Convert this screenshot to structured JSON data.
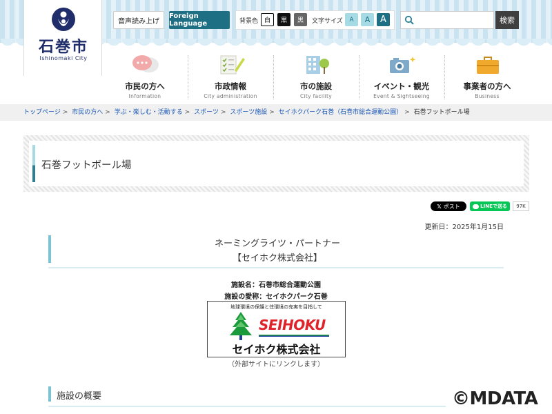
{
  "header": {
    "logo": {
      "name": "石巻市",
      "sub": "Ishinomaki City"
    },
    "voice_label": "音声読み上げ",
    "language_label": "Foreign Language",
    "bg_color_label": "背景色",
    "bg_options": [
      "白",
      "黒",
      "黒"
    ],
    "font_size_label": "文字サイズ",
    "font_sizes": [
      "A",
      "A",
      "A"
    ],
    "search": {
      "placeholder": "",
      "button": "検索"
    }
  },
  "nav": [
    {
      "label": "市民の方へ",
      "sub": "Information",
      "icon": "speech-bubbles-icon"
    },
    {
      "label": "市政情報",
      "sub": "City administration",
      "icon": "checklist-pencil-icon"
    },
    {
      "label": "市の施設",
      "sub": "City facility",
      "icon": "building-tree-icon"
    },
    {
      "label": "イベント・観光",
      "sub": "Event & Sightseeing",
      "icon": "camera-icon"
    },
    {
      "label": "事業者の方へ",
      "sub": "Business",
      "icon": "briefcase-icon"
    }
  ],
  "breadcrumb": {
    "items": [
      "トップページ",
      "市民の方へ",
      "学ぶ・楽しむ・活動する",
      "スポーツ",
      "スポーツ施設",
      "セイホクパーク石巻（石巻市総合運動公園）"
    ],
    "separator": ">",
    "current": "石巻フットボール場"
  },
  "page_title": "石巻フットボール場",
  "social": {
    "x_post": "ポスト",
    "line": "LINEで送る",
    "count": "97K"
  },
  "updated": "更新日：2025年1月15日",
  "section1": {
    "line1": "ネーミングライツ・パートナー",
    "line2": "【セイホク株式会社】"
  },
  "facility": {
    "name": "施設名：石巻市総合運動公園",
    "nickname": "施設の愛称：セイホクパーク石巻"
  },
  "banner": {
    "tagline": "地球環境の保護と住環境の充実を目指して",
    "brand": "SEIHOKU",
    "company": "セイホク株式会社",
    "note": "（外部サイトにリンクします）"
  },
  "section2": {
    "title": "施設の概要"
  },
  "watermark": "©MDATA",
  "colors": {
    "accent": "#1f6f84",
    "link": "#1a57b5",
    "heading_bar": "#7cc3d4",
    "brand_red": "#e0232b"
  }
}
